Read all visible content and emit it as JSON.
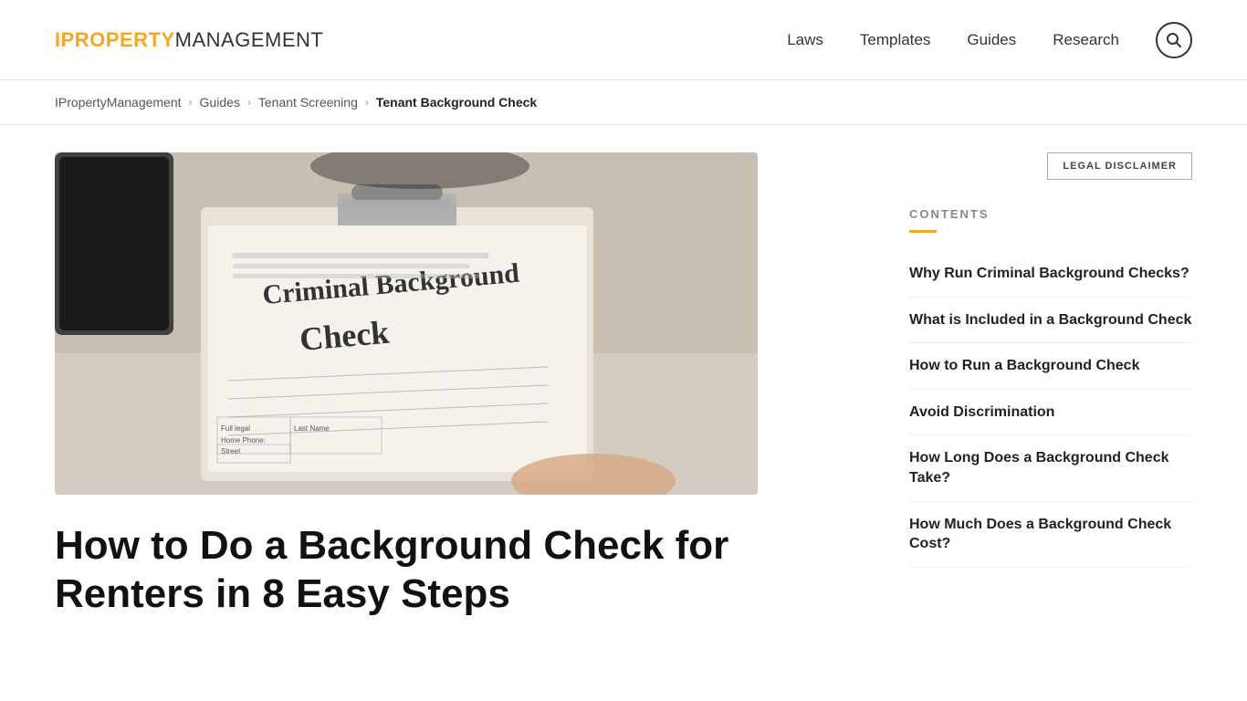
{
  "header": {
    "logo_highlight": "iPROPERTY",
    "logo_rest": "MANAGEMENT",
    "nav": {
      "laws": "Laws",
      "templates": "Templates",
      "guides": "Guides",
      "research": "Research"
    },
    "search_icon": "search"
  },
  "breadcrumb": {
    "items": [
      {
        "label": "IPropertyManagement",
        "href": "#"
      },
      {
        "label": "Guides",
        "href": "#"
      },
      {
        "label": "Tenant Screening",
        "href": "#"
      },
      {
        "label": "Tenant Background Check",
        "href": "#",
        "current": true
      }
    ],
    "separator": "›"
  },
  "legal_disclaimer": "LEGAL DISCLAIMER",
  "contents": {
    "title": "CONTENTS",
    "items": [
      {
        "label": "Why Run Criminal Background Checks?",
        "href": "#"
      },
      {
        "label": "What is Included in a Background Check",
        "href": "#"
      },
      {
        "label": "How to Run a Background Check",
        "href": "#"
      },
      {
        "label": "Avoid Discrimination",
        "href": "#"
      },
      {
        "label": "How Long Does a Background Check Take?",
        "href": "#"
      },
      {
        "label": "How Much Does a Background Check Cost?",
        "href": "#"
      }
    ]
  },
  "article": {
    "title": "How to Do a Background Check for Renters in 8 Easy Steps"
  }
}
